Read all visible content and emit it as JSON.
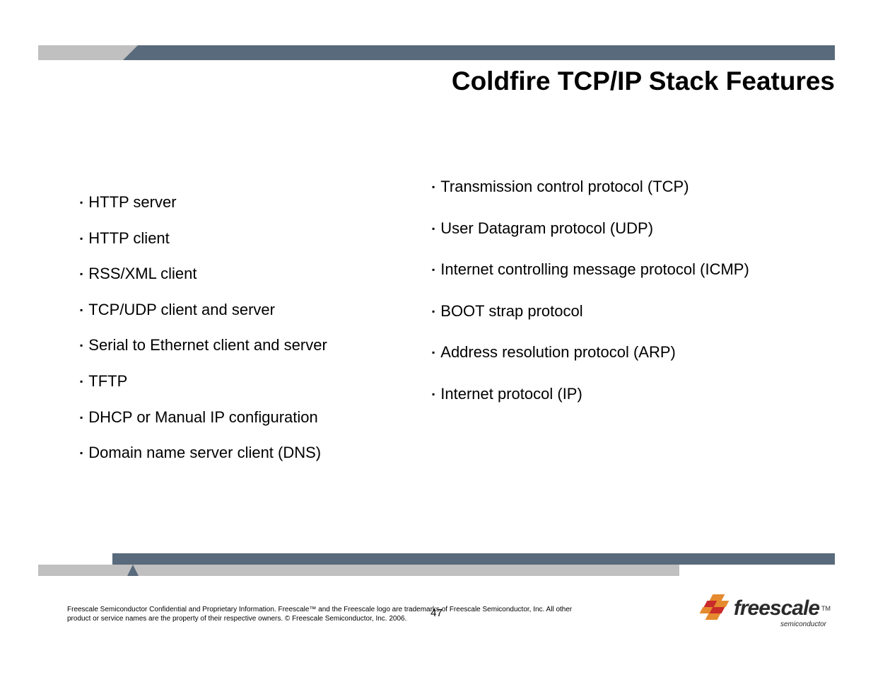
{
  "title": "Coldfire TCP/IP Stack Features",
  "left_items": [
    "HTTP server",
    "HTTP client",
    "RSS/XML client",
    "TCP/UDP client and server",
    "Serial to Ethernet client and server",
    "TFTP",
    "DHCP or Manual IP configuration",
    "Domain name server client (DNS)"
  ],
  "right_items": [
    "Transmission control protocol (TCP)",
    "User Datagram protocol (UDP)",
    "Internet controlling message protocol (ICMP)",
    "BOOT strap protocol",
    "Address resolution protocol (ARP)",
    "Internet protocol (IP)"
  ],
  "legal": "Freescale Semiconductor Confidential and Proprietary Information. Freescale™ and the Freescale logo are trademarks of Freescale Semiconductor, Inc. All other product or service names are the property of their respective owners. © Freescale Semiconductor, Inc. 2006.",
  "page_number": "47",
  "logo": {
    "brand": "freescale",
    "tm": "TM",
    "sub": "semiconductor"
  }
}
